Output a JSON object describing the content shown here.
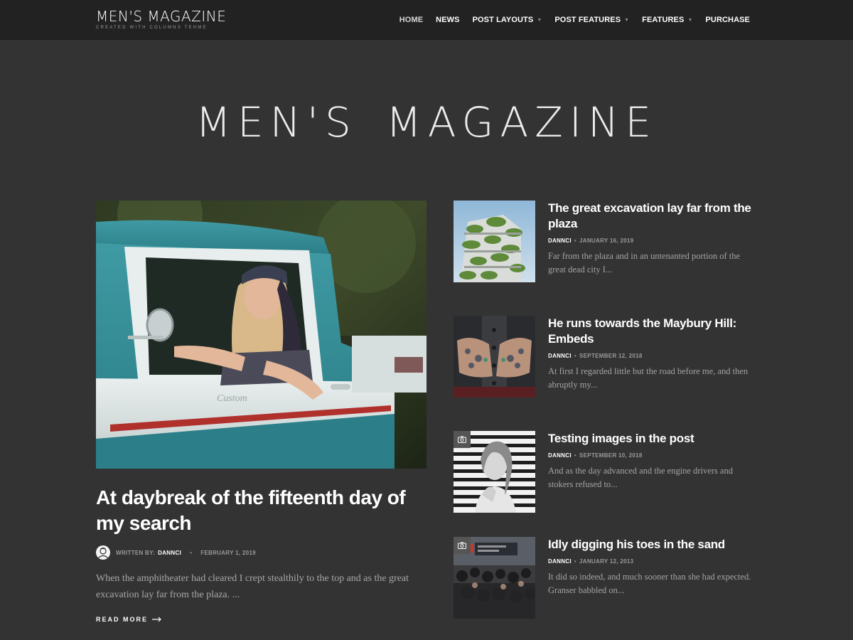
{
  "header": {
    "logo_main": "MEN'S MAGAZINE",
    "logo_sub": "CREATED WITH COLUMNS TEHME",
    "nav": [
      {
        "label": "HOME",
        "active": true,
        "dropdown": false
      },
      {
        "label": "NEWS",
        "active": false,
        "dropdown": false
      },
      {
        "label": "POST LAYOUTS",
        "active": false,
        "dropdown": true
      },
      {
        "label": "POST FEATURES",
        "active": false,
        "dropdown": true
      },
      {
        "label": "FEATURES",
        "active": false,
        "dropdown": true
      },
      {
        "label": "PURCHASE",
        "active": false,
        "dropdown": false
      }
    ]
  },
  "hero": {
    "title_part1": "MEN'S",
    "title_part2": "MAGAZINE"
  },
  "featured": {
    "title": "At daybreak of the fifteenth day of my search",
    "meta_label": "WRITTEN BY:",
    "author": "DANNCI",
    "date": "FEBRUARY 1, 2019",
    "excerpt": "When the amphitheater had cleared I crept stealthily to the top and as the great excavation lay far from the plaza. ...",
    "read_more": "READ MORE",
    "image_icon": "vintage-truck-photo"
  },
  "posts": [
    {
      "title": "The great excavation lay far from the plaza",
      "author": "DANNCI",
      "date": "JANUARY 16, 2019",
      "excerpt": "Far from the plaza and in an untenanted portion of the great dead city I...",
      "image_icon": "green-building-photo",
      "badge": false
    },
    {
      "title": "He runs towards the Maybury Hill: Embeds",
      "author": "DANNCI",
      "date": "SEPTEMBER 12, 2018",
      "excerpt": "At first I regarded little but the road before me, and then abruptly my...",
      "image_icon": "tattooed-hands-photo",
      "badge": false
    },
    {
      "title": "Testing images in the post",
      "author": "DANNCI",
      "date": "SEPTEMBER 10, 2018",
      "excerpt": "And as the day advanced and the engine drivers and stokers refused to...",
      "image_icon": "striped-portrait-photo",
      "badge": true
    },
    {
      "title": "Idly digging his toes in the sand",
      "author": "DANNCI",
      "date": "JANUARY 12, 2013",
      "excerpt": "It did so indeed, and much sooner than she had expected. Granser babbled on...",
      "image_icon": "city-crowd-photo",
      "badge": true
    }
  ],
  "colors": {
    "background": "#333333",
    "topbar": "#222222",
    "text": "#ffffff",
    "muted": "#a4a4a4"
  }
}
